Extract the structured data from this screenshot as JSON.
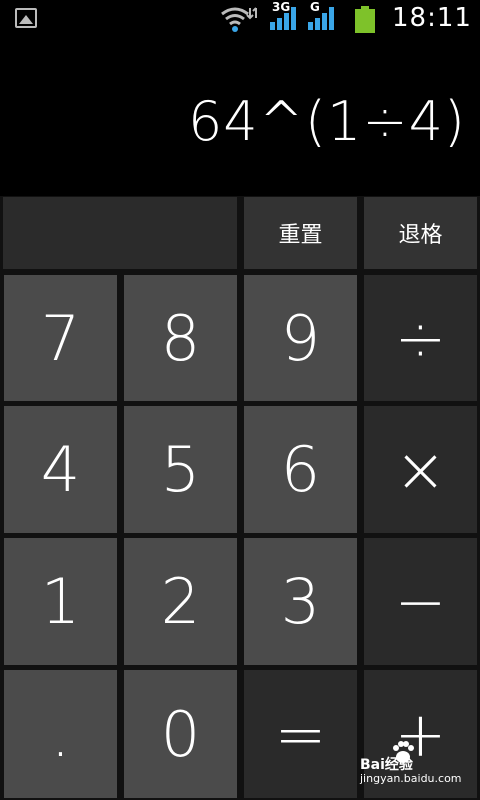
{
  "status": {
    "network_3g": "3G",
    "network_g": "G",
    "time": "18:11"
  },
  "display": {
    "expression": "64^(1÷4)"
  },
  "function_row": {
    "clear_label": "重置",
    "backspace_label": "退格"
  },
  "keys": {
    "seven": "7",
    "eight": "8",
    "nine": "9",
    "divide": "÷",
    "four": "4",
    "five": "5",
    "six": "6",
    "multiply": "×",
    "one": "1",
    "two": "2",
    "three": "3",
    "minus": "−",
    "dot": ".",
    "zero": "0",
    "equals": "=",
    "plus": "+"
  },
  "watermark": {
    "text": "jingyan.baidu.com",
    "brand": "Bai经验"
  }
}
